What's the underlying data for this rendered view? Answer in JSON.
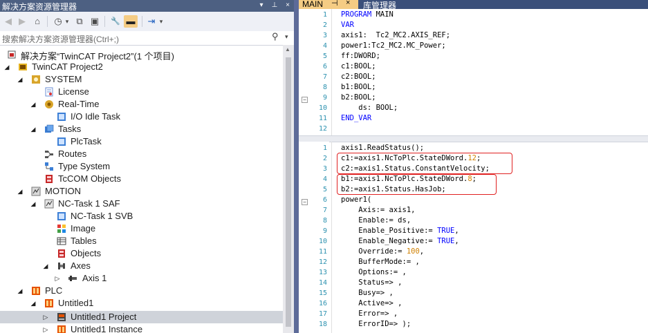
{
  "explorer": {
    "title": "解决方案资源管理器",
    "title_buttons": [
      "▾",
      "⊥",
      "×"
    ],
    "toolbar": {
      "back": "◀",
      "forward": "▶",
      "home": "⌂",
      "history": "◷",
      "history_drop": "▾",
      "sync": "⧉",
      "properties": "▣",
      "wrench": "🔧",
      "collapse": "▬",
      "pin": "⇥",
      "pin_drop": "▾"
    },
    "search": {
      "placeholder": "搜索解决方案资源管理器(Ctrl+;)",
      "icon": "⚲",
      "drop": "▾"
    },
    "tree": [
      {
        "label": "解决方案“TwinCAT Project2”(1 个项目)",
        "arrow": "",
        "icon": "solution-icon"
      },
      {
        "label": "TwinCAT Project2",
        "arrow": "◢",
        "icon": "project-icon"
      },
      {
        "label": "SYSTEM",
        "arrow": "◢",
        "icon": "system-icon"
      },
      {
        "label": "License",
        "arrow": "",
        "icon": "license-icon"
      },
      {
        "label": "Real-Time",
        "arrow": "◢",
        "icon": "realtime-icon"
      },
      {
        "label": "I/O Idle Task",
        "arrow": "",
        "icon": "task-icon"
      },
      {
        "label": "Tasks",
        "arrow": "◢",
        "icon": "tasks-icon"
      },
      {
        "label": "PlcTask",
        "arrow": "",
        "icon": "task-icon"
      },
      {
        "label": "Routes",
        "arrow": "",
        "icon": "routes-icon"
      },
      {
        "label": "Type System",
        "arrow": "",
        "icon": "type-system-icon"
      },
      {
        "label": "TcCOM Objects",
        "arrow": "",
        "icon": "tccom-icon"
      },
      {
        "label": "MOTION",
        "arrow": "◢",
        "icon": "motion-icon"
      },
      {
        "label": "NC-Task 1 SAF",
        "arrow": "◢",
        "icon": "nc-task-icon"
      },
      {
        "label": "NC-Task 1 SVB",
        "arrow": "",
        "icon": "task-icon"
      },
      {
        "label": "Image",
        "arrow": "",
        "icon": "image-icon"
      },
      {
        "label": "Tables",
        "arrow": "",
        "icon": "tables-icon"
      },
      {
        "label": "Objects",
        "arrow": "",
        "icon": "objects-icon"
      },
      {
        "label": "Axes",
        "arrow": "◢",
        "icon": "axes-icon"
      },
      {
        "label": "Axis 1",
        "arrow": "▷",
        "icon": "axis-icon"
      },
      {
        "label": "PLC",
        "arrow": "◢",
        "icon": "plc-icon"
      },
      {
        "label": "Untitled1",
        "arrow": "◢",
        "icon": "plc-project-icon"
      },
      {
        "label": "Untitled1 Project",
        "arrow": "▷",
        "icon": "plc-sub-icon"
      },
      {
        "label": "Untitled1 Instance",
        "arrow": "▷",
        "icon": "plc-instance-icon"
      }
    ]
  },
  "editor": {
    "tabs": [
      {
        "label": "MAIN",
        "pin": "⊣",
        "close": "×"
      },
      {
        "label": "库管理器"
      }
    ],
    "declaration": {
      "lines": [
        {
          "n": "1",
          "k": "PROGRAM",
          "t": " MAIN"
        },
        {
          "n": "2",
          "k": "VAR",
          "t": ""
        },
        {
          "n": "3",
          "k": "",
          "t": "axis1:  Tc2_MC2.AXIS_REF;"
        },
        {
          "n": "4",
          "k": "",
          "t": "power1:Tc2_MC2.MC_Power;"
        },
        {
          "n": "5",
          "k": "",
          "t": "ff:DWORD;"
        },
        {
          "n": "6",
          "k": "",
          "t": "c1:BOOL;"
        },
        {
          "n": "7",
          "k": "",
          "t": "c2:BOOL;"
        },
        {
          "n": "8",
          "k": "",
          "t": "b1:BOOL;"
        },
        {
          "n": "9",
          "k": "",
          "t": "b2:BOOL;"
        },
        {
          "n": "10",
          "k": "",
          "t": "    ds: BOOL;"
        },
        {
          "n": "11",
          "k": "END_VAR",
          "t": ""
        },
        {
          "n": "12",
          "k": "",
          "t": ""
        }
      ]
    },
    "implementation": {
      "lines": [
        {
          "n": "1",
          "t": "axis1.ReadStatus();"
        },
        {
          "n": "2",
          "t": "c1:=axis1.NcToPlc.StateDWord.",
          "num": "12",
          "tail": ";"
        },
        {
          "n": "3",
          "t": "c2:=axis1.Status.ConstantVelocity;"
        },
        {
          "n": "4",
          "t": "b1:=axis1.NcToPlc.StateDWord.",
          "num": "8",
          "tail": ";"
        },
        {
          "n": "5",
          "t": "b2:=axis1.Status.HasJob;"
        },
        {
          "n": "6",
          "t": "power1("
        },
        {
          "n": "7",
          "t": "    Axis:= axis1,"
        },
        {
          "n": "8",
          "t": "    Enable:= ds,"
        },
        {
          "n": "9",
          "t": "    Enable_Positive:= ",
          "kw": "TRUE",
          "tail": ","
        },
        {
          "n": "10",
          "t": "    Enable_Negative:= ",
          "kw": "TRUE",
          "tail": ","
        },
        {
          "n": "11",
          "t": "    Override:= ",
          "num": "100",
          "tail": ","
        },
        {
          "n": "12",
          "t": "    BufferMode:= ,"
        },
        {
          "n": "13",
          "t": "    Options:= ,"
        },
        {
          "n": "14",
          "t": "    Status=> ,"
        },
        {
          "n": "15",
          "t": "    Busy=> ,"
        },
        {
          "n": "16",
          "t": "    Active=> ,"
        },
        {
          "n": "17",
          "t": "    Error=> ,"
        },
        {
          "n": "18",
          "t": "    ErrorID=> );"
        }
      ]
    }
  },
  "colors": {
    "title_bar": "#4d6082",
    "tab_active": "#f5cc84",
    "keyword": "#0000ff",
    "number": "#d08000",
    "highlight_box": "#e02020",
    "line_number": "#2b91af"
  }
}
